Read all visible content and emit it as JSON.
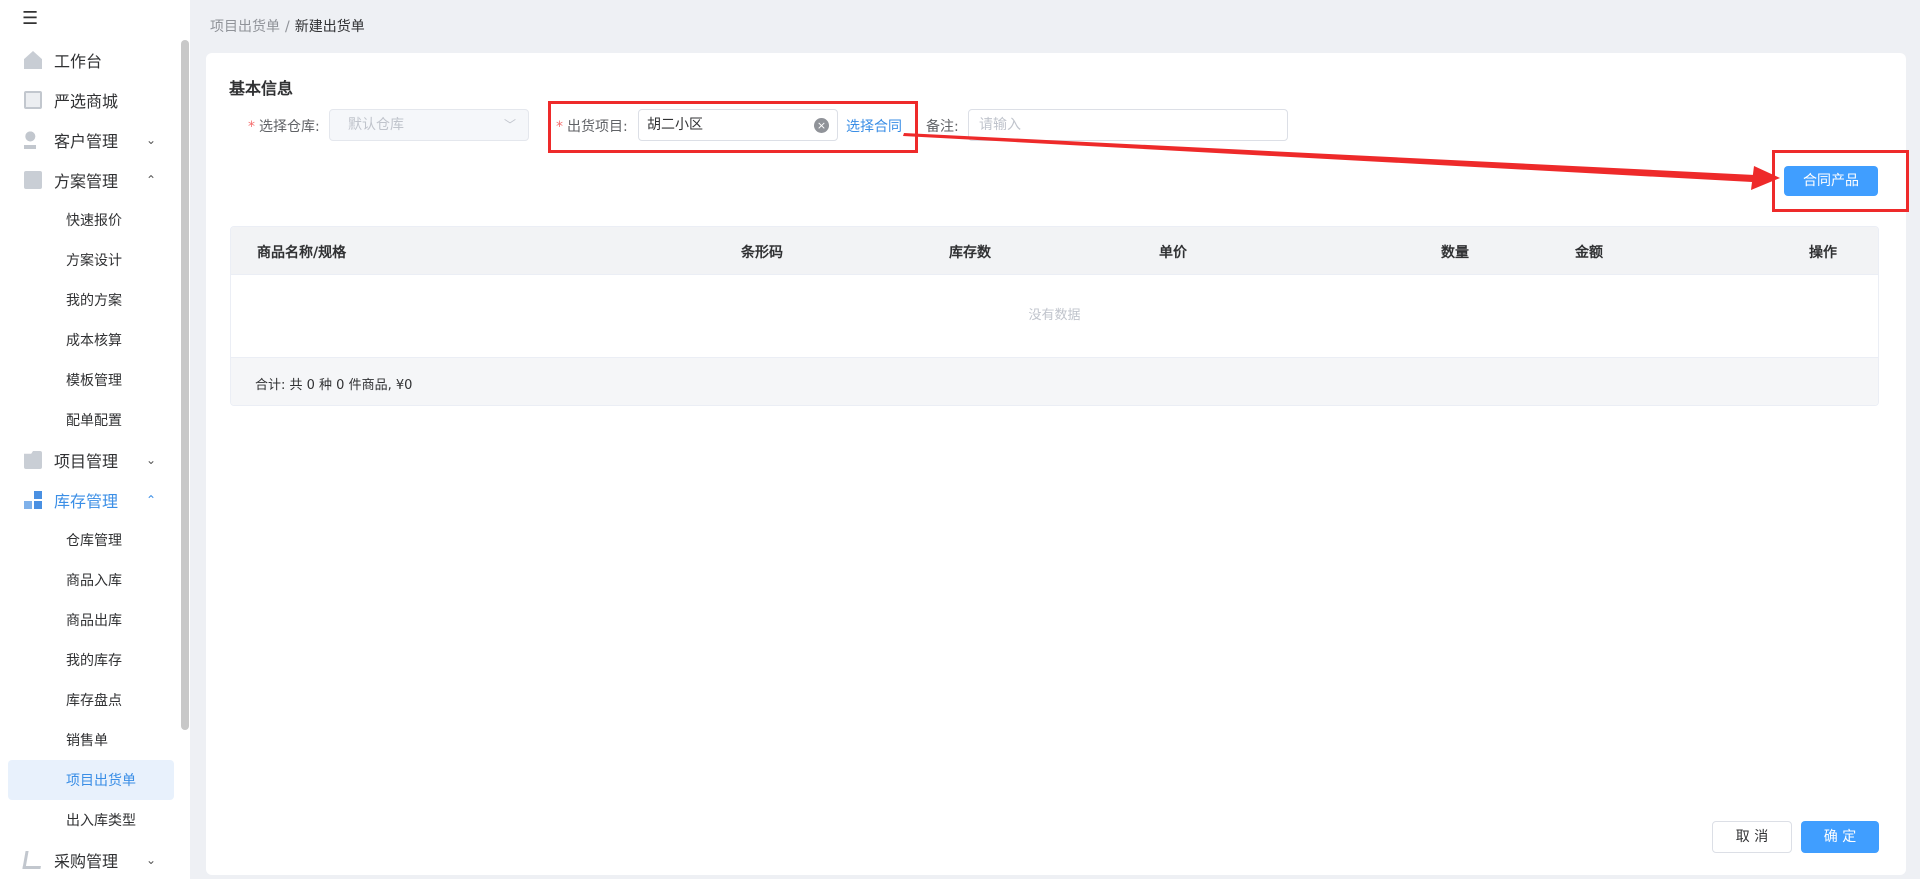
{
  "breadcrumb": {
    "parent": "项目出货单",
    "separator": "/",
    "current": "新建出货单"
  },
  "sidebar": {
    "items": [
      {
        "label": "工作台",
        "icon": "home-icon"
      },
      {
        "label": "严选商城",
        "icon": "shop-icon"
      },
      {
        "label": "客户管理",
        "icon": "customer-icon",
        "arrow": "⌄"
      },
      {
        "label": "方案管理",
        "icon": "plan-icon",
        "arrow": "⌃"
      },
      {
        "label": "项目管理",
        "icon": "folder-icon",
        "arrow": "⌄"
      },
      {
        "label": "库存管理",
        "icon": "stock-icon",
        "arrow": "⌃"
      },
      {
        "label": "采购管理",
        "icon": "cart-icon",
        "arrow": "⌄"
      }
    ],
    "plan_sub": [
      "快速报价",
      "方案设计",
      "我的方案",
      "成本核算",
      "模板管理",
      "配单配置"
    ],
    "stock_sub": [
      "仓库管理",
      "商品入库",
      "商品出库",
      "我的库存",
      "库存盘点",
      "销售单",
      "项目出货单",
      "出入库类型"
    ]
  },
  "form": {
    "section_title": "基本信息",
    "warehouse_label": "选择仓库:",
    "warehouse_value": "默认仓库",
    "project_label": "出货项目:",
    "project_value": "胡二小区",
    "select_contract": "选择合同",
    "remark_label": "备注:",
    "remark_placeholder": "请输入",
    "required_mark": "*",
    "clear_symbol": "×"
  },
  "buttons": {
    "contract_products": "合同产品",
    "cancel": "取 消",
    "confirm": "确 定"
  },
  "table": {
    "columns": [
      "商品名称/规格",
      "条形码",
      "库存数",
      "单价",
      "数量",
      "金额",
      "操作"
    ],
    "empty_text": "没有数据",
    "summary": "合计: 共 0 种 0 件商品, ¥0"
  },
  "colors": {
    "primary": "#409eff",
    "annotation": "#ee2a2a",
    "active_text": "#3a8ee6"
  }
}
